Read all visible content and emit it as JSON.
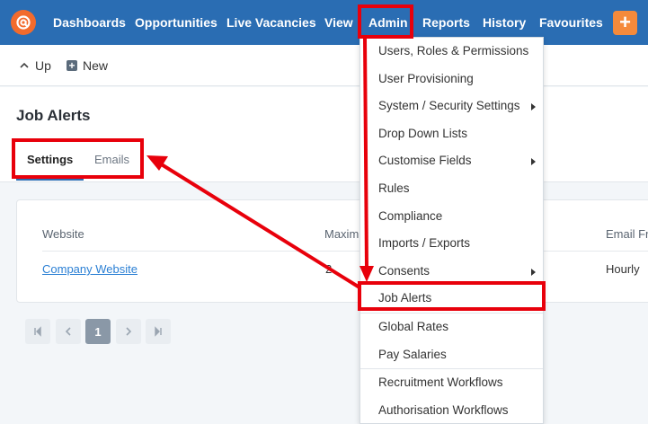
{
  "nav": {
    "items": [
      "Dashboards",
      "Opportunities",
      "Live Vacancies",
      "View",
      "Admin",
      "Reports",
      "History",
      "Favourites"
    ],
    "plus": "+"
  },
  "toolbar": {
    "up_label": "Up",
    "new_label": "New"
  },
  "page": {
    "title": "Job Alerts"
  },
  "tabs": {
    "settings": "Settings",
    "emails": "Emails"
  },
  "table": {
    "headers": [
      "Website",
      "Maxim",
      "Email Fr"
    ],
    "row": {
      "website": "Company Website",
      "max": "2",
      "frequency": "Hourly"
    }
  },
  "pagination": {
    "current": "1"
  },
  "admin_menu": {
    "items": [
      "Users, Roles & Permissions",
      "User Provisioning",
      "System / Security Settings",
      "Drop Down Lists",
      "Customise Fields",
      "Rules",
      "Compliance",
      "Imports / Exports",
      "Consents",
      "Job Alerts",
      "Global Rates",
      "Pay Salaries",
      "Recruitment Workflows",
      "Authorisation Workflows"
    ]
  },
  "colors": {
    "nav_bg": "#2a6db3",
    "accent_orange": "#f26b2d",
    "annotation_red": "#e8000b",
    "link": "#2a7fd4"
  }
}
